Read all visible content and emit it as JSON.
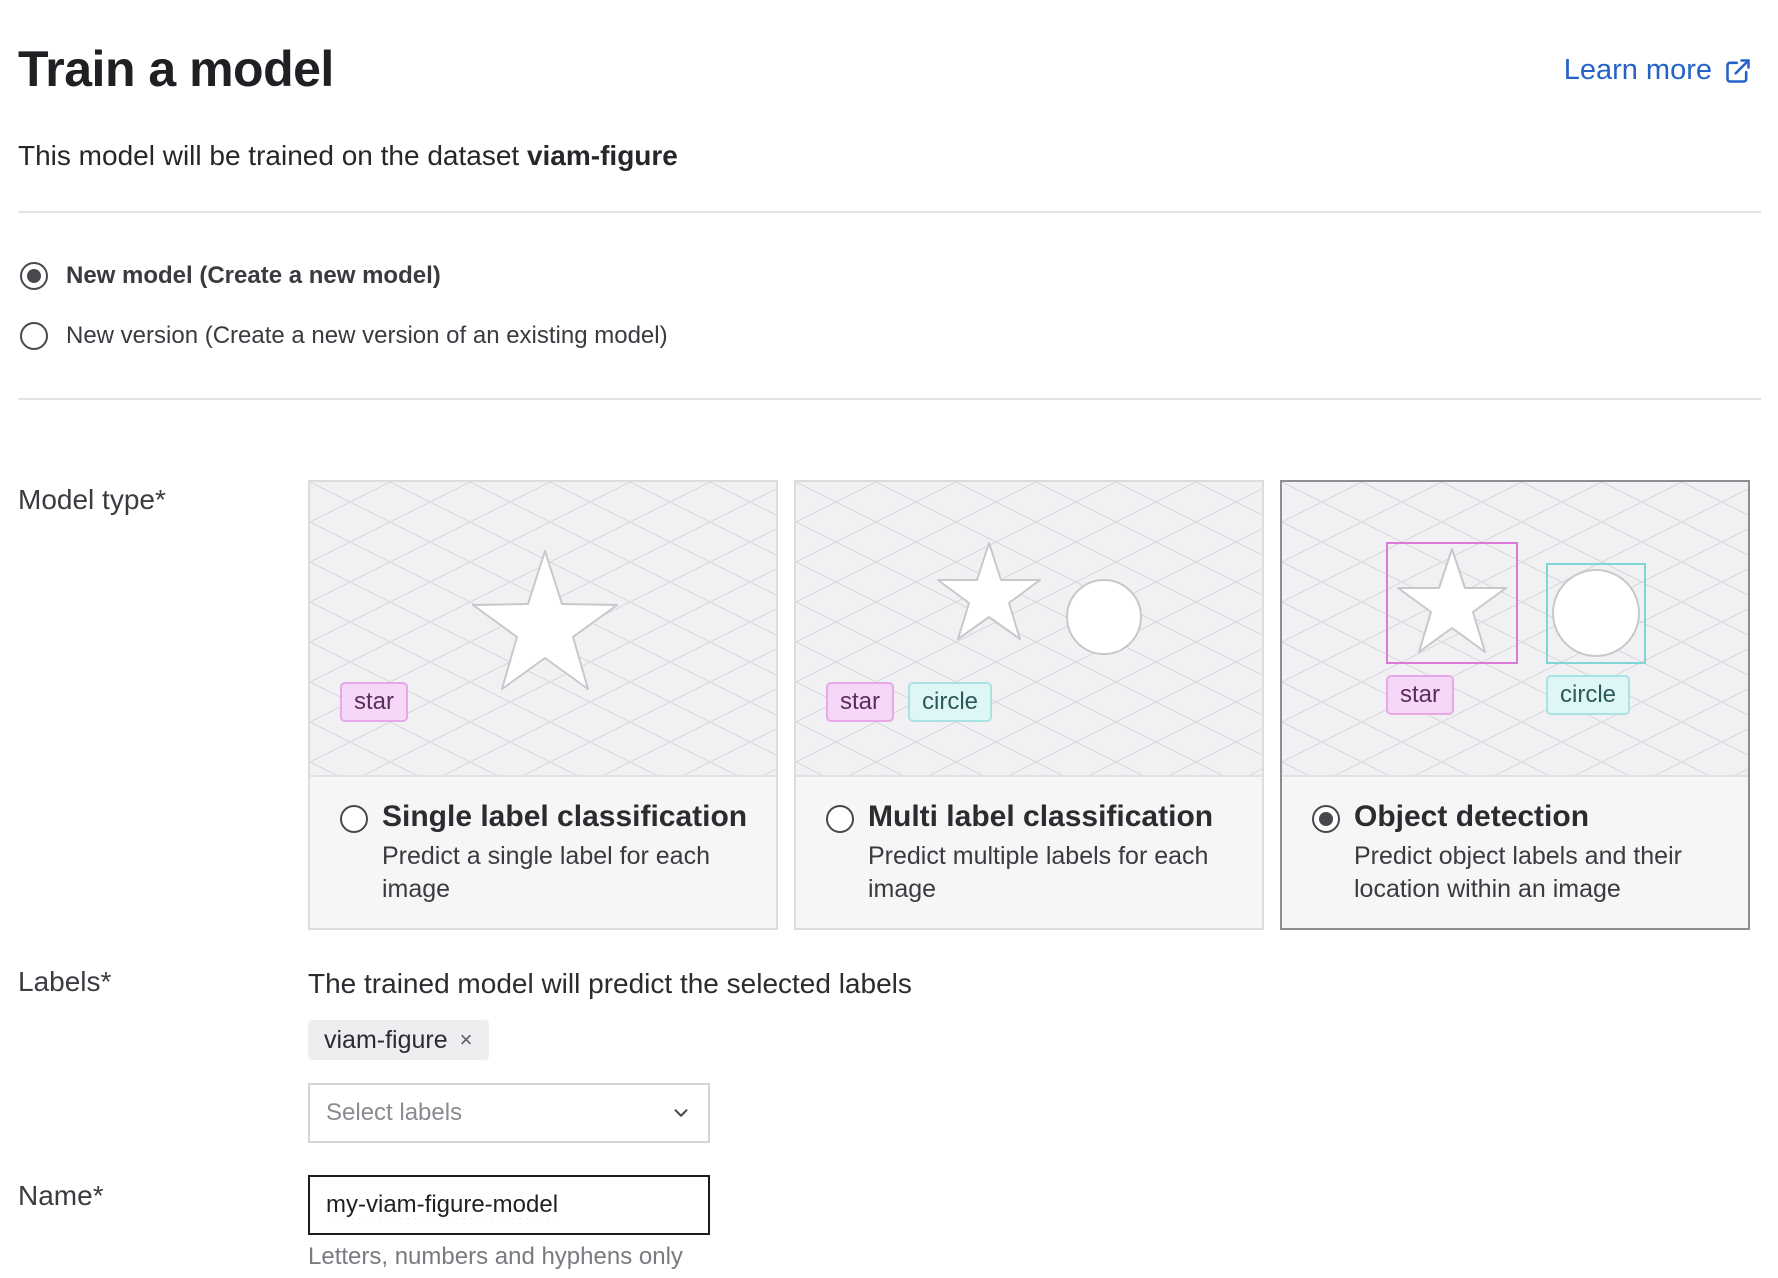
{
  "header": {
    "title": "Train a model",
    "learn_more": "Learn more",
    "subtitle_prefix": "This model will be trained on the dataset ",
    "dataset": "viam-figure"
  },
  "model_mode": {
    "options": [
      {
        "label": "New model (Create a new model)",
        "selected": true
      },
      {
        "label": "New version (Create a new version of an existing model)",
        "selected": false
      }
    ]
  },
  "model_type": {
    "label": "Model type*",
    "cards": [
      {
        "title": "Single label classification",
        "description": "Predict a single label for each image",
        "selected": false,
        "tags": [
          "star"
        ]
      },
      {
        "title": "Multi label classification",
        "description": "Predict multiple labels for each image",
        "selected": false,
        "tags": [
          "star",
          "circle"
        ]
      },
      {
        "title": "Object detection",
        "description": "Predict object labels and their location within an image",
        "selected": true,
        "tags": [
          "star",
          "circle"
        ]
      }
    ]
  },
  "labels": {
    "label": "Labels*",
    "help": "The trained model will predict the selected labels",
    "chips": [
      "viam-figure"
    ],
    "chip_remove_icon": "×",
    "select_placeholder": "Select labels"
  },
  "name": {
    "label": "Name*",
    "value": "my-viam-figure-model",
    "hint": "Letters, numbers and hyphens only"
  },
  "colors": {
    "link": "#2563c9",
    "star_tag_bg": "#f7d7f7",
    "star_box": "#d97ad9",
    "circle_tag_bg": "#dff6f6",
    "circle_box": "#7fd6d6"
  },
  "icons": {
    "learn_more": "external-link-icon",
    "select": "chevron-down-icon",
    "chip_remove": "close-icon"
  }
}
